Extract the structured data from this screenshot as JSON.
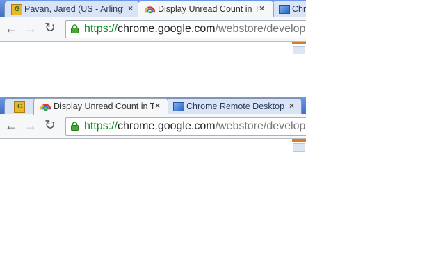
{
  "window1": {
    "tabs": [
      {
        "title": "Pavan, Jared (US - Arlingto",
        "icon": "gmail-icon",
        "active": false
      },
      {
        "title": "Display Unread Count in T",
        "icon": "unread-count-extension-icon",
        "active": true
      },
      {
        "title": "Chr",
        "icon": "chrome-remote-desktop-icon",
        "active": false
      }
    ],
    "url": {
      "scheme": "https://",
      "host": "chrome.google.com",
      "path": "/webstore/develope"
    }
  },
  "window2": {
    "tabs": [
      {
        "title": "",
        "icon": "gmail-icon",
        "active": false
      },
      {
        "title": "Display Unread Count in T",
        "icon": "unread-count-extension-icon",
        "active": true
      },
      {
        "title": "Chrome Remote Desktop",
        "icon": "chrome-remote-desktop-icon",
        "active": false
      }
    ],
    "url": {
      "scheme": "https://",
      "host": "chrome.google.com",
      "path": "/webstore/develope"
    }
  },
  "icons": {
    "close": "×",
    "back": "←",
    "forward": "→",
    "reload": "↻"
  },
  "colors": {
    "tabstrip": "#4e7fd6",
    "secure_scheme": "#0a8a1f"
  }
}
